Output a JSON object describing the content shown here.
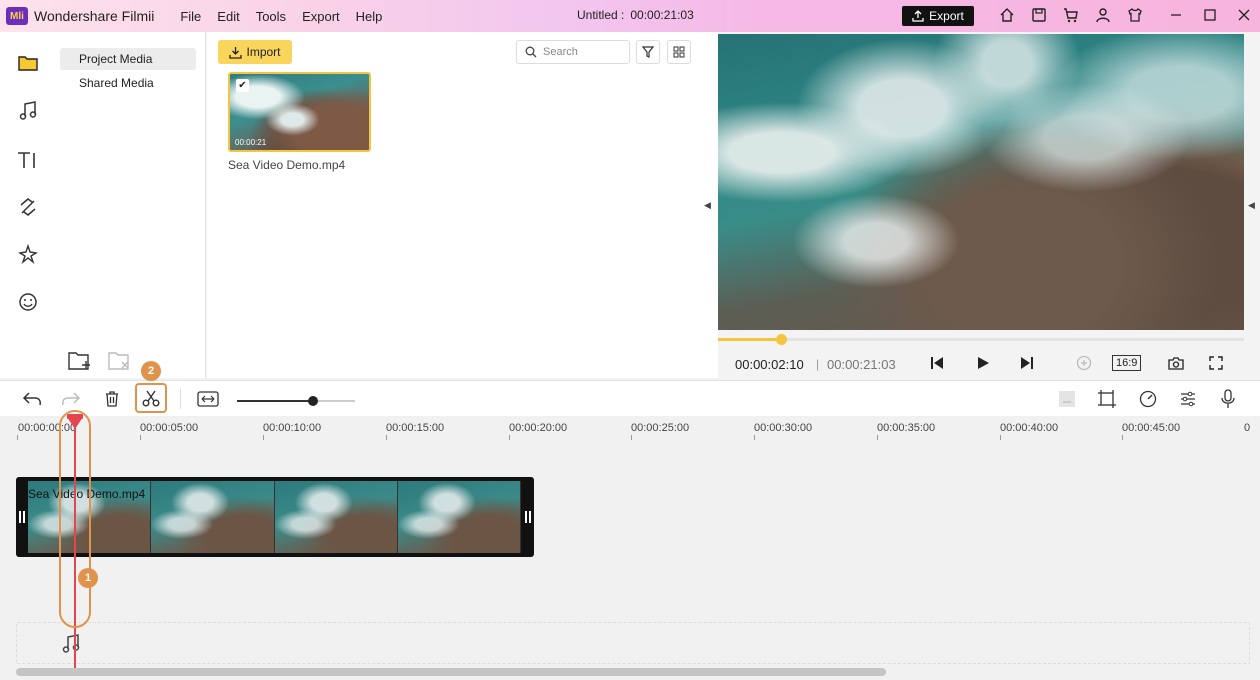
{
  "app": {
    "logo_text": "Mli",
    "name": "Wondershare Filmii",
    "menus": [
      "File",
      "Edit",
      "Tools",
      "Export",
      "Help"
    ],
    "doc_title": "Untitled :",
    "doc_duration": "00:00:21:03",
    "export_label": "Export"
  },
  "sidebar": {
    "icons": [
      "folder-icon",
      "music-icon",
      "text-icon",
      "transition-icon",
      "effects-icon",
      "sticker-icon"
    ]
  },
  "nav": {
    "items": [
      {
        "label": "Project Media",
        "active": true
      },
      {
        "label": "Shared Media",
        "active": false
      }
    ]
  },
  "media": {
    "import_label": "Import",
    "search_placeholder": "Search",
    "items": [
      {
        "filename": "Sea Video Demo.mp4",
        "duration": "00:00:21",
        "selected": true
      }
    ]
  },
  "preview": {
    "current_time": "00:00:02:10",
    "total_time": "00:00:21:03",
    "aspect_ratio": "16:9",
    "progress": 0.12
  },
  "timeline": {
    "zoom_level": 0.64,
    "ruler_labels": [
      "00:00:00:00",
      "00:00:05:00",
      "00:00:10:00",
      "00:00:15:00",
      "00:00:20:00",
      "00:00:25:00",
      "00:00:30:00",
      "00:00:35:00",
      "00:00:40:00",
      "00:00:45:00",
      "0"
    ],
    "clip_name": "Sea Video Demo.mp4",
    "annotations": [
      "1",
      "2"
    ]
  },
  "colors": {
    "accent": "#f5c542",
    "annotation": "#e0934c",
    "playhead": "#e5464d",
    "export_bg": "#111111"
  }
}
